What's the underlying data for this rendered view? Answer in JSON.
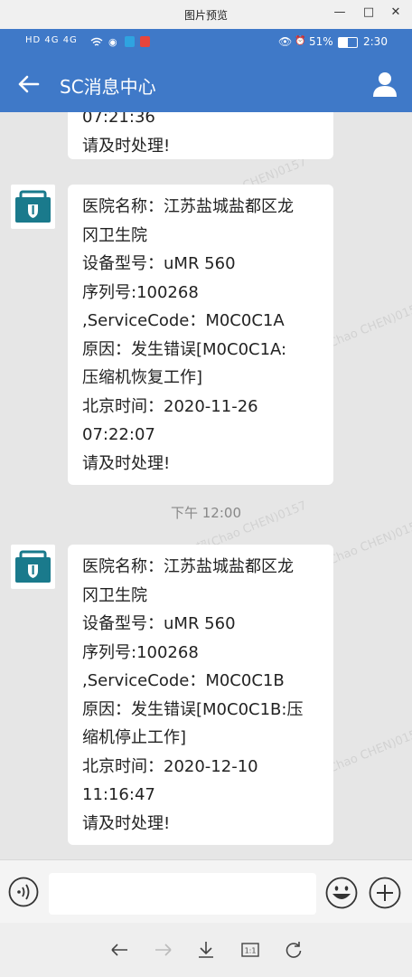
{
  "window": {
    "title": "图片预览"
  },
  "status_bar": {
    "left_indicators": "HD 4G 4G",
    "battery": "51%",
    "time": "2:30"
  },
  "header": {
    "title": "SC消息中心"
  },
  "messages": [
    {
      "lines": [
        "07:21:36",
        "请及时处理!"
      ]
    },
    {
      "lines": [
        "医院名称：江苏盐城盐都区龙",
        "冈卫生院",
        "设备型号：uMR 560",
        "序列号:100268",
        ",ServiceCode：M0C0C1A",
        "原因：发生错误[M0C0C1A:",
        "压缩机恢复工作]",
        "北京时间：2020-11-26",
        "07:22:07",
        "请及时处理!"
      ]
    },
    {
      "lines": [
        "医院名称：江苏盐城盐都区龙",
        "冈卫生院",
        "设备型号：uMR 560",
        "序列号:100268",
        ",ServiceCode：M0C0C1B",
        "原因：发生错误[M0C0C1B:压",
        "缩机停止工作]",
        "北京时间：2020-12-10",
        "11:16:47",
        "请及时处理!"
      ]
    }
  ],
  "timestamp": "下午 12:00",
  "watermark": "陈超(Chao CHEN)0157",
  "colors": {
    "accent": "#3f79c8",
    "avatar": "#1a7a8c"
  }
}
